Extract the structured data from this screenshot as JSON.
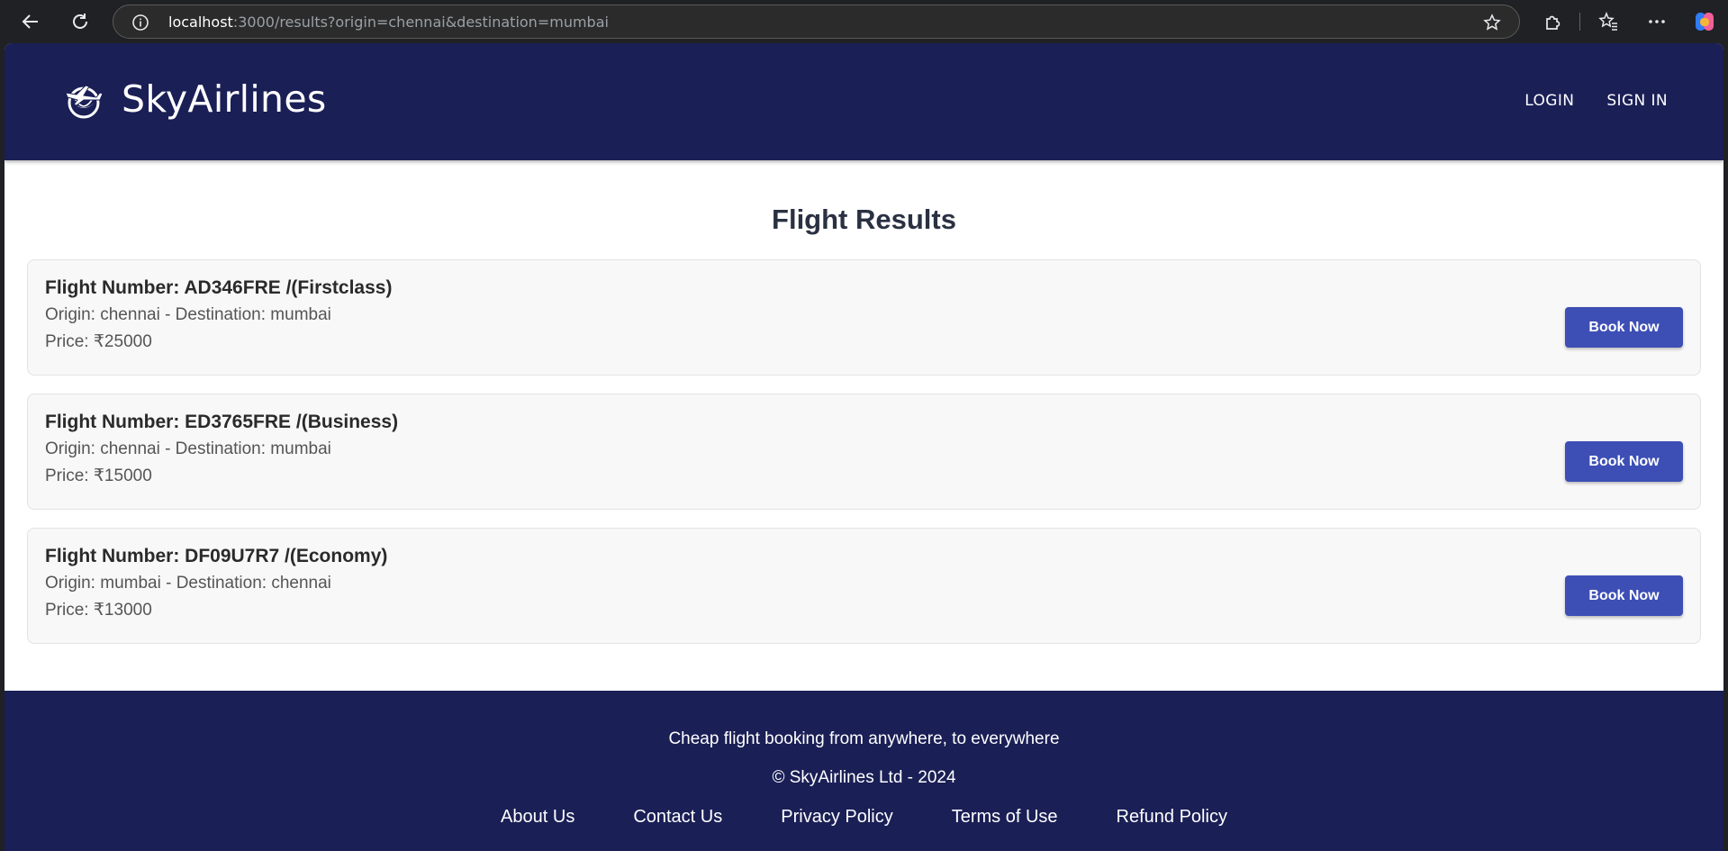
{
  "browser": {
    "url_host": "localhost",
    "url_rest": ":3000/results?origin=chennai&destination=mumbai"
  },
  "header": {
    "brand": "SkyAirlines",
    "nav": [
      "LOGIN",
      "SIGN IN"
    ]
  },
  "main": {
    "title": "Flight Results",
    "flights": [
      {
        "number": "Flight Number: AD346FRE /(Firstclass)",
        "route": "Origin: chennai - Destination: mumbai",
        "price": "Price: ₹25000",
        "button": "Book Now"
      },
      {
        "number": "Flight Number: ED3765FRE /(Business)",
        "route": "Origin: chennai - Destination: mumbai",
        "price": "Price: ₹15000",
        "button": "Book Now"
      },
      {
        "number": "Flight Number: DF09U7R7 /(Economy)",
        "route": "Origin: mumbai - Destination: chennai",
        "price": "Price: ₹13000",
        "button": "Book Now"
      }
    ]
  },
  "footer": {
    "tagline": "Cheap flight booking from anywhere, to everywhere",
    "copyright": "© SkyAirlines Ltd - 2024",
    "links": [
      "About Us",
      "Contact Us",
      "Privacy Policy",
      "Terms of Use",
      "Refund Policy"
    ]
  },
  "colors": {
    "primary_dark": "#1a1f56",
    "button": "#3d4fb5",
    "card_bg": "#f8f8f8"
  },
  "icons": [
    "back-arrow-icon",
    "refresh-icon",
    "info-icon",
    "star-icon",
    "extensions-icon",
    "favorites-icon",
    "more-icon",
    "copilot-icon",
    "airplane-globe-logo"
  ]
}
